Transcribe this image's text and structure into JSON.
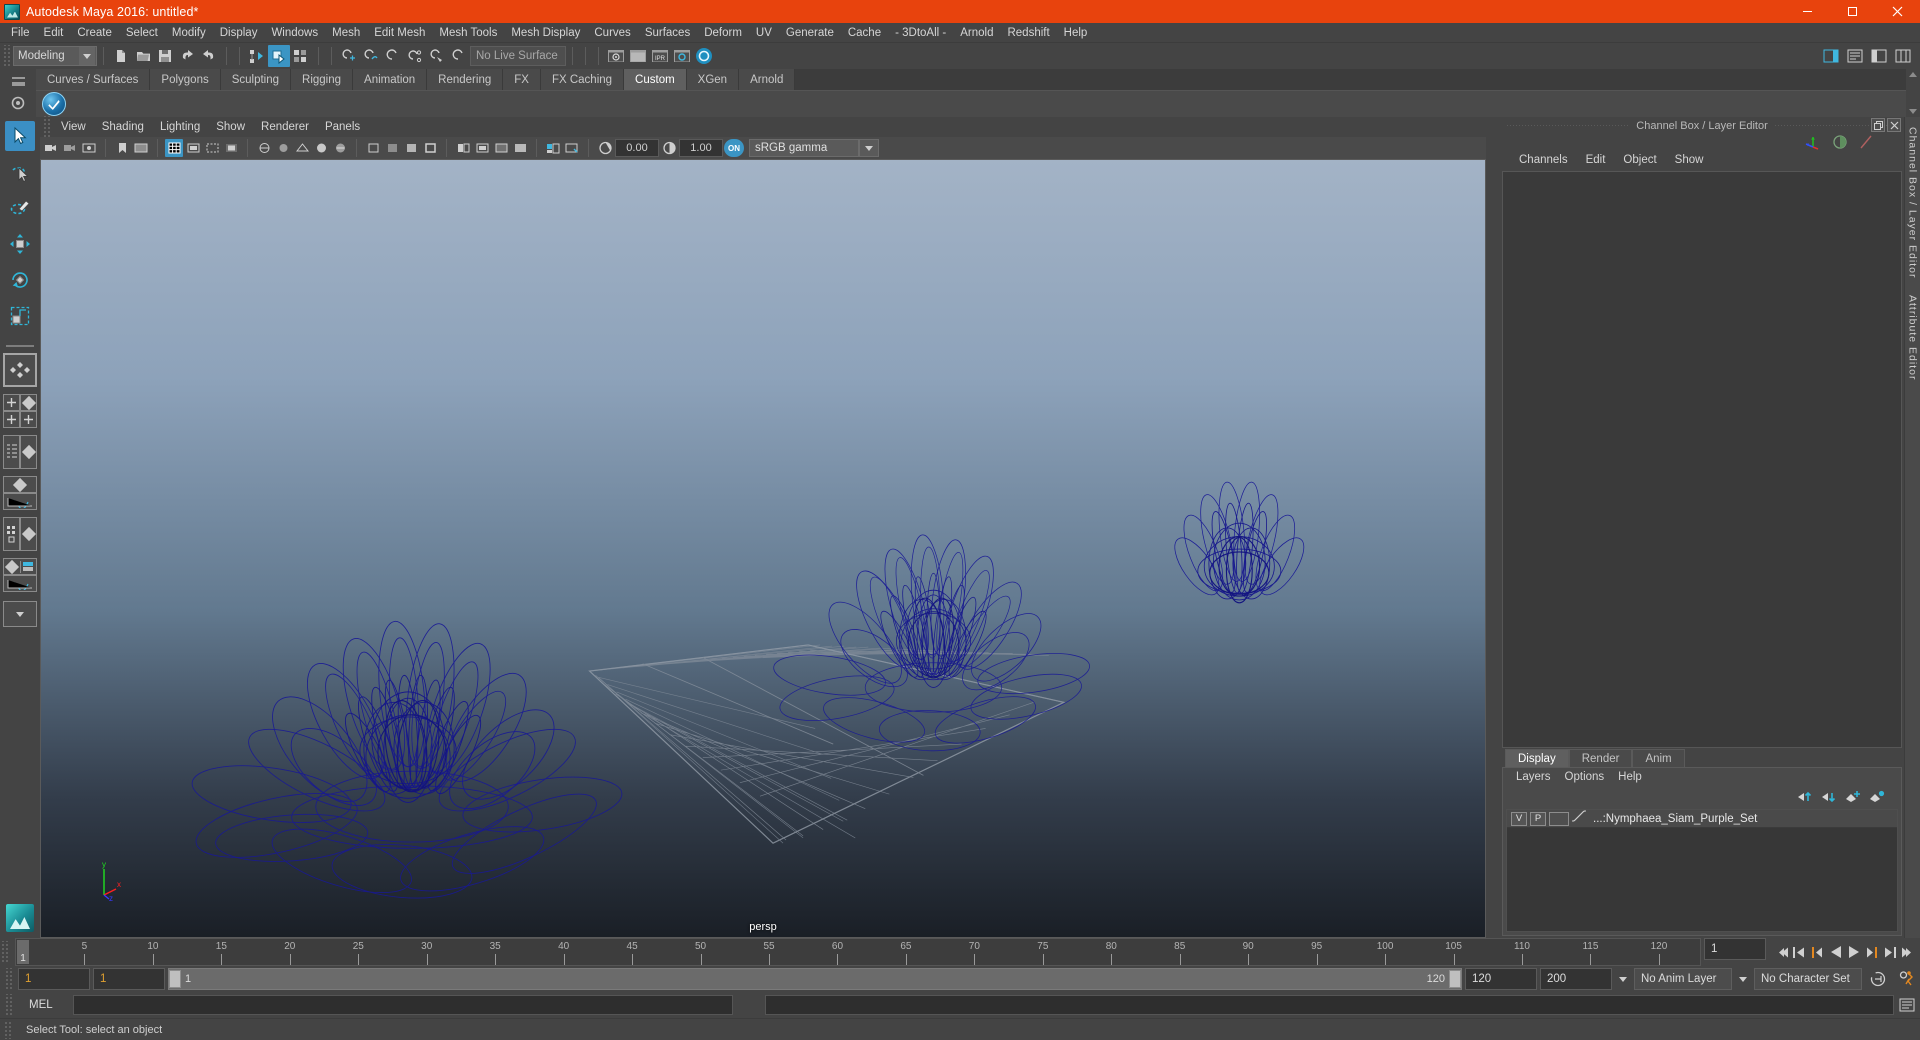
{
  "window": {
    "title": "Autodesk Maya 2016: untitled*",
    "app_icon": "maya-logo-icon",
    "minimize_label": "–",
    "maximize_label": "❐",
    "close_label": "✕",
    "titlebar_color": "#e8430d"
  },
  "menubar": {
    "items": [
      {
        "label": "File"
      },
      {
        "label": "Edit"
      },
      {
        "label": "Create"
      },
      {
        "label": "Select"
      },
      {
        "label": "Modify"
      },
      {
        "label": "Display"
      },
      {
        "label": "Windows"
      },
      {
        "label": "Mesh"
      },
      {
        "label": "Edit Mesh"
      },
      {
        "label": "Mesh Tools"
      },
      {
        "label": "Mesh Display"
      },
      {
        "label": "Curves"
      },
      {
        "label": "Surfaces"
      },
      {
        "label": "Deform"
      },
      {
        "label": "UV"
      },
      {
        "label": "Generate"
      },
      {
        "label": "Cache"
      },
      {
        "label": "- 3DtoAll -"
      },
      {
        "label": "Arnold"
      },
      {
        "label": "Redshift"
      },
      {
        "label": "Help"
      }
    ]
  },
  "statusbar": {
    "menuset": {
      "value": "Modeling",
      "icon": "chevron-down-icon"
    },
    "live_surface": {
      "value": "No Live Surface"
    },
    "icons": [
      "new-scene-icon",
      "open-scene-icon",
      "save-scene-icon",
      "undo-icon",
      "redo-icon",
      "select-by-hierarchy-icon",
      "select-by-object-icon",
      "select-by-component-icon",
      "snap-grid-icon",
      "snap-curve-icon",
      "snap-point-icon",
      "snap-projectcenter-icon",
      "snap-view-plane-icon",
      "make-live-icon",
      "render-current-frame-icon",
      "ipr-render-icon",
      "render-settings-icon",
      "hypershade-icon"
    ],
    "right_icons": [
      "sidebar-toggle-icon",
      "attribute-editor-icon",
      "tool-settings-icon",
      "channel-box-icon"
    ]
  },
  "shelf": {
    "tabs": [
      {
        "label": "Curves / Surfaces",
        "selected": false
      },
      {
        "label": "Polygons",
        "selected": false
      },
      {
        "label": "Sculpting",
        "selected": false
      },
      {
        "label": "Rigging",
        "selected": false
      },
      {
        "label": "Animation",
        "selected": false
      },
      {
        "label": "Rendering",
        "selected": false
      },
      {
        "label": "FX",
        "selected": false
      },
      {
        "label": "FX Caching",
        "selected": false
      },
      {
        "label": "Custom",
        "selected": true
      },
      {
        "label": "XGen",
        "selected": false
      },
      {
        "label": "Arnold",
        "selected": false
      }
    ],
    "item_icon": "checkmark-badge-icon"
  },
  "toolbox": {
    "tools": [
      {
        "name": "select-tool",
        "selected": true
      },
      {
        "name": "lasso-select-tool",
        "selected": false
      },
      {
        "name": "paint-select-tool",
        "selected": false
      },
      {
        "name": "move-tool",
        "selected": false
      },
      {
        "name": "rotate-tool",
        "selected": false
      },
      {
        "name": "scale-tool",
        "selected": false
      }
    ],
    "layouts": [
      {
        "name": "single-perspective-layout"
      },
      {
        "name": "four-view-layout"
      },
      {
        "name": "outliner-persp-layout"
      },
      {
        "name": "persp-graph-layout"
      },
      {
        "name": "hypershade-persp-layout"
      },
      {
        "name": "persp-outliner-graph-layout"
      },
      {
        "name": "more-layouts"
      }
    ]
  },
  "viewport": {
    "menus": [
      {
        "label": "View"
      },
      {
        "label": "Shading"
      },
      {
        "label": "Lighting"
      },
      {
        "label": "Show"
      },
      {
        "label": "Renderer"
      },
      {
        "label": "Panels"
      }
    ],
    "exposure_value": "0.00",
    "gamma_value": "1.00",
    "color_profile": "sRGB gamma",
    "gamma_toggle_label": "ON",
    "camera_label": "persp",
    "axis_labels": {
      "x": "x",
      "y": "y",
      "z": "z"
    },
    "axis_colors": {
      "x": "#ff2020",
      "y": "#20e020",
      "z": "#3838ff"
    },
    "model_color": "#1a1a9e",
    "background_top": "#9fb0c4",
    "background_bottom": "#1b2128",
    "toolbar_icons": [
      "select-camera-icon",
      "lock-camera-icon",
      "camera-attributes-icon",
      "bookmark-icon",
      "image-plane-icon",
      "two-pane-icon",
      "grid-toggle-icon",
      "film-gate-icon",
      "resolution-gate-icon",
      "gate-mask-icon",
      "xray-icon",
      "xray-joints-icon",
      "wireframe-icon",
      "smooth-shade-icon",
      "smooth-shade-textured-icon",
      "use-all-lights-icon",
      "shadows-icon",
      "screen-space-ao-icon",
      "motion-blur-icon",
      "multisample-icon",
      "depth-peeling-icon",
      "isolate-select-icon",
      "xray-active-components-icon",
      "grid-display-icon",
      "hud-icon",
      "exposure-icon",
      "gamma-icon",
      "color-management-icon"
    ]
  },
  "channelbox": {
    "panel_title": "Channel Box / Layer Editor",
    "restore_icon": "restore-panel-icon",
    "close_icon": "close-panel-icon",
    "menus": [
      {
        "label": "Channels"
      },
      {
        "label": "Edit"
      },
      {
        "label": "Object"
      },
      {
        "label": "Show"
      }
    ],
    "tool_icons": [
      "manipulator-icon",
      "half-tone-icon",
      "slash-icon"
    ],
    "side_tabs": [
      "Channel Box / Layer Editor",
      "Attribute Editor"
    ]
  },
  "layer_editor": {
    "tabs": [
      {
        "label": "Display",
        "selected": true
      },
      {
        "label": "Render",
        "selected": false
      },
      {
        "label": "Anim",
        "selected": false
      }
    ],
    "menus": [
      {
        "label": "Layers"
      },
      {
        "label": "Options"
      },
      {
        "label": "Help"
      }
    ],
    "icons": [
      "move-layer-up-icon",
      "move-layer-down-icon",
      "new-layer-icon",
      "new-layer-from-selected-icon"
    ],
    "layers": [
      {
        "visibility": "V",
        "playback": "P",
        "type_swatch": "",
        "name": "...:Nymphaea_Siam_Purple_Set"
      }
    ]
  },
  "timeline": {
    "current_frame": "1",
    "tick_labels": [
      "5",
      "10",
      "15",
      "20",
      "25",
      "30",
      "35",
      "40",
      "45",
      "50",
      "55",
      "60",
      "65",
      "70",
      "75",
      "80",
      "85",
      "90",
      "95",
      "100",
      "105",
      "110",
      "115",
      "120"
    ],
    "tick_values": [
      5,
      10,
      15,
      20,
      25,
      30,
      35,
      40,
      45,
      50,
      55,
      60,
      65,
      70,
      75,
      80,
      85,
      90,
      95,
      100,
      105,
      110,
      115,
      120
    ],
    "range_min": 1,
    "range_max": 120,
    "playback_buttons": [
      "go-to-start-icon",
      "step-back-keyframe-icon",
      "step-back-frame-icon",
      "play-backwards-icon",
      "play-forwards-icon",
      "step-forward-frame-icon",
      "step-forward-keyframe-icon",
      "go-to-end-icon"
    ]
  },
  "range_slider": {
    "anim_start": "1",
    "range_start": "1",
    "slider_left_value": "1",
    "slider_right_value": "120",
    "range_end": "120",
    "anim_end": "200",
    "anim_layer": "No Anim Layer",
    "character_set": "No Character Set",
    "auto_key_icon": "auto-keyframe-icon",
    "anim_prefs_icon": "animation-preferences-icon"
  },
  "command_line": {
    "language_label": "MEL",
    "input_value": "",
    "output_value": "",
    "script_editor_icon": "script-editor-icon"
  },
  "status_line": {
    "message": "Select Tool: select an object"
  }
}
